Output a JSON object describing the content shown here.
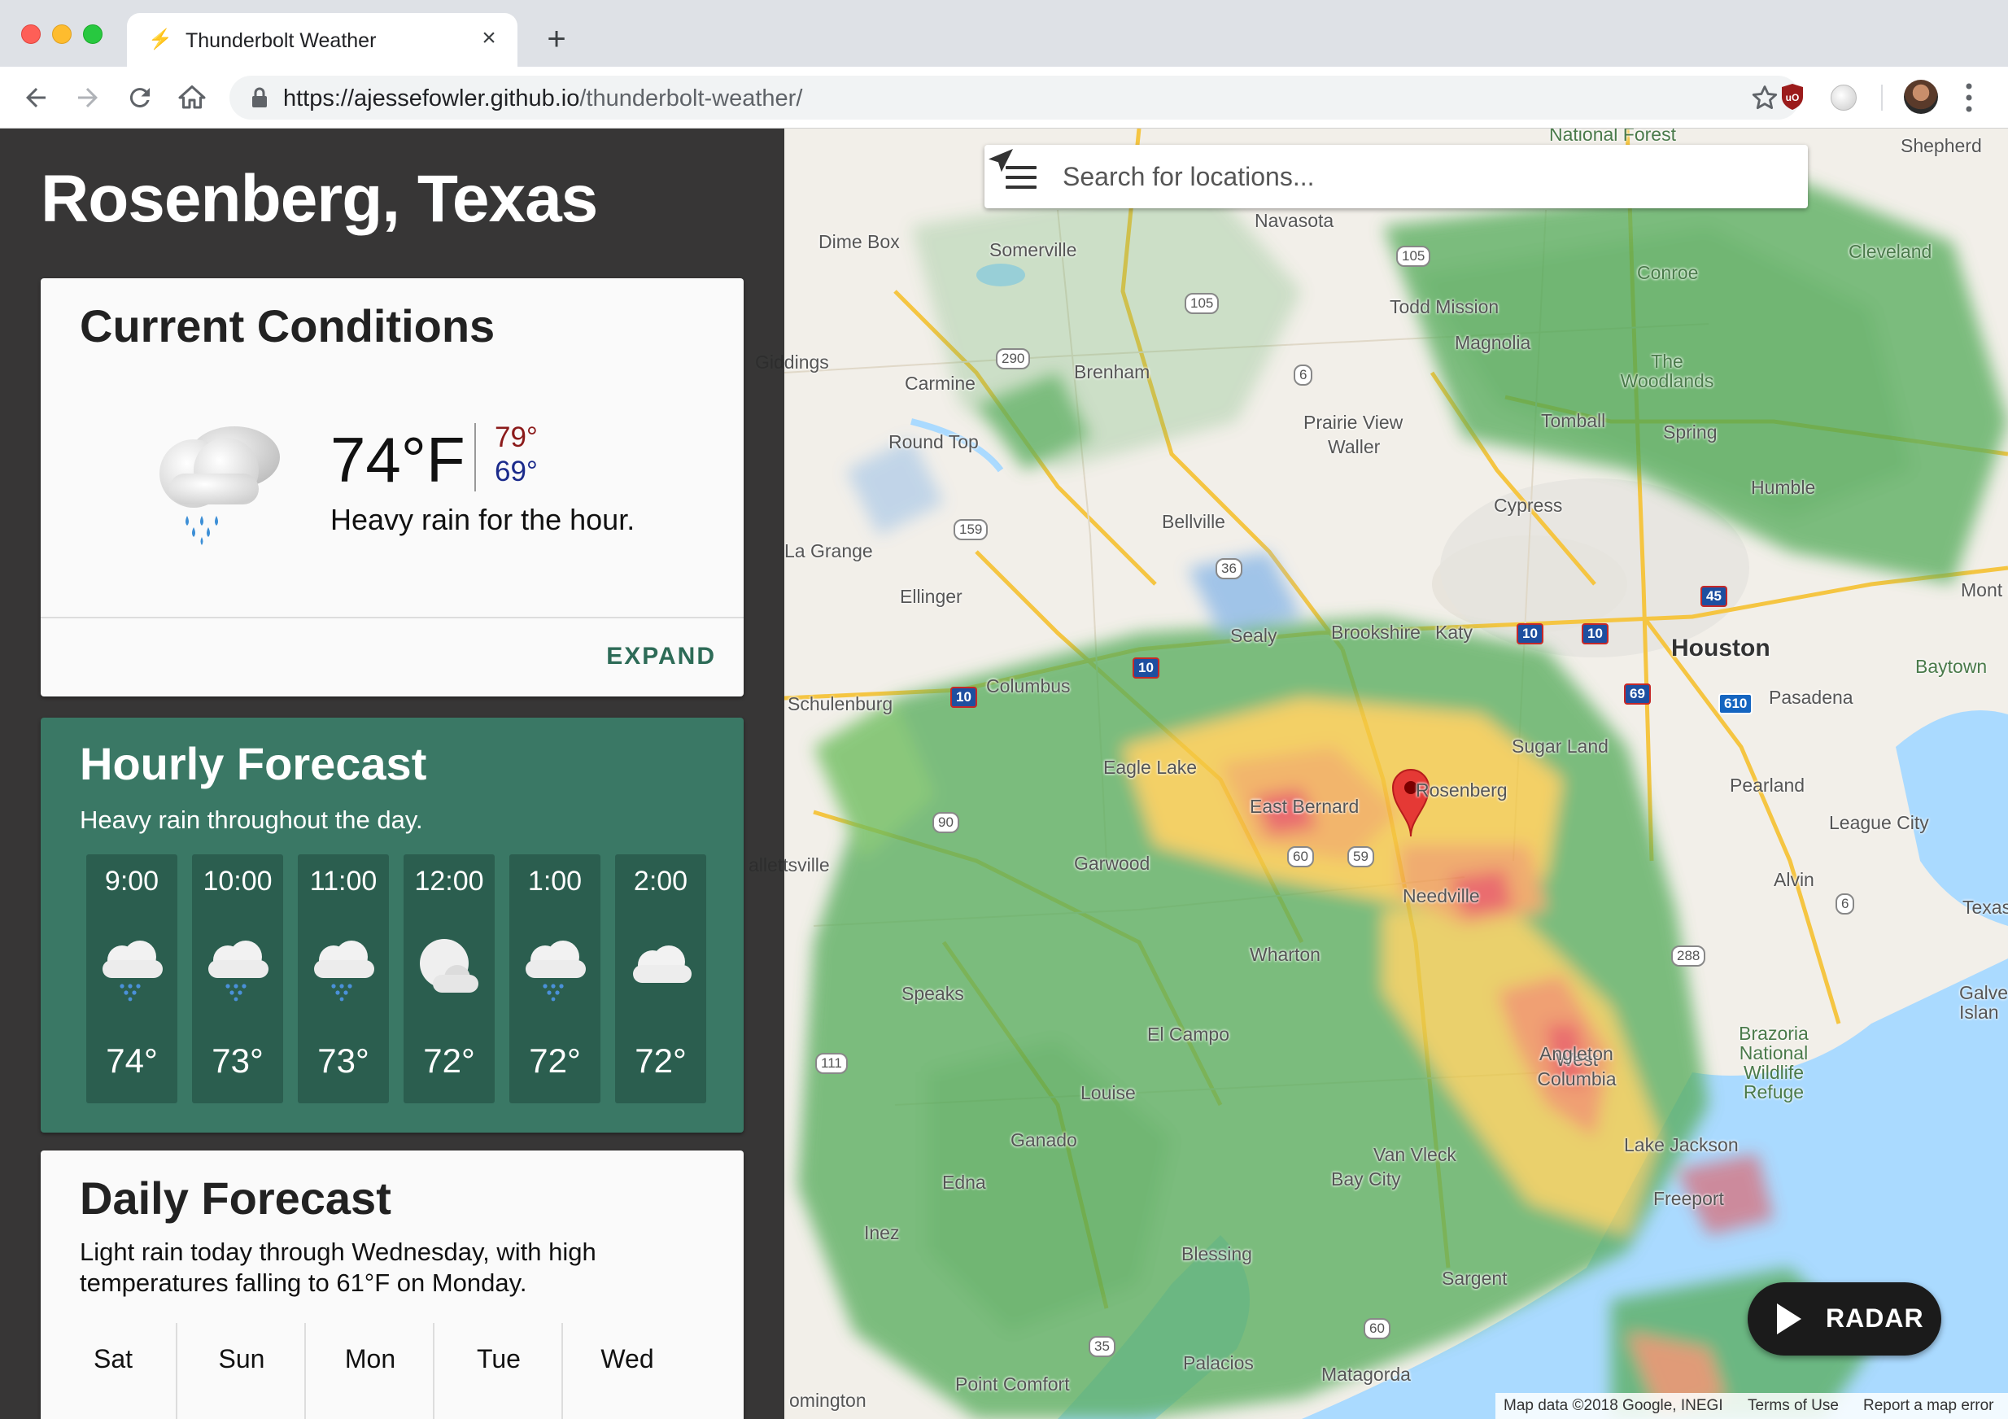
{
  "browser": {
    "tab_title": "Thunderbolt Weather",
    "url_host": "https://ajessefowler.github.io",
    "url_path": "/thunderbolt-weather/"
  },
  "search": {
    "placeholder": "Search for locations..."
  },
  "location": {
    "title": "Rosenberg, Texas"
  },
  "current": {
    "title": "Current Conditions",
    "temp": "74°F",
    "high": "79°",
    "low": "69°",
    "summary": "Heavy rain for the hour.",
    "icon": "rain-icon",
    "expand_label": "EXPAND"
  },
  "hourly": {
    "title": "Hourly Forecast",
    "summary": "Heavy rain throughout the day.",
    "hours": [
      {
        "time": "9:00",
        "temp": "74°",
        "icon": "rain-icon"
      },
      {
        "time": "10:00",
        "temp": "73°",
        "icon": "rain-icon"
      },
      {
        "time": "11:00",
        "temp": "73°",
        "icon": "rain-icon"
      },
      {
        "time": "12:00",
        "temp": "72°",
        "icon": "partly-cloudy-night-icon"
      },
      {
        "time": "1:00",
        "temp": "72°",
        "icon": "rain-icon"
      },
      {
        "time": "2:00",
        "temp": "72°",
        "icon": "cloudy-icon"
      }
    ]
  },
  "daily": {
    "title": "Daily Forecast",
    "summary": "Light rain today through Wednesday, with high temperatures falling to 61°F on Monday.",
    "days": [
      {
        "name": "Sat",
        "icon": "sun-icon"
      },
      {
        "name": "Sun",
        "icon": "sun-icon"
      },
      {
        "name": "Mon",
        "icon": "cloudy-icon"
      },
      {
        "name": "Tue",
        "icon": "cloudy-icon"
      },
      {
        "name": "Wed",
        "icon": "cloudy-icon"
      }
    ]
  },
  "radar_button": {
    "label": "RADAR"
  },
  "map": {
    "attribution": "Map data ©2018 Google, INEGI",
    "terms": "Terms of Use",
    "report": "Report a map error",
    "places": {
      "houston": "Houston",
      "pasadena": "Pasadena",
      "sugar_land": "Sugar Land",
      "pearland": "Pearland",
      "league_city": "League City",
      "rosenberg": "Rosenberg",
      "sealy": "Sealy",
      "brookshire": "Brookshire",
      "katy": "Katy",
      "columbus": "Columbus",
      "eagle_lake": "Eagle Lake",
      "east_bernard": "East Bernard",
      "needville": "Needville",
      "wharton": "Wharton",
      "el_campo": "El Campo",
      "west_columbia": "West Columbia",
      "navasota": "Navasota",
      "somerville": "Somerville",
      "dime_box": "Dime Box",
      "todd_mission": "Todd Mission",
      "magnolia": "Magnolia",
      "conroe": "Conroe",
      "the_woodlands": "The Woodlands",
      "tomball": "Tomball",
      "spring": "Spring",
      "humble": "Humble",
      "cypress": "Cypress",
      "brenham": "Brenham",
      "carmine": "Carmine",
      "round_top": "Round Top",
      "prairie_view": "Prairie View",
      "waller": "Waller",
      "bellville": "Bellville",
      "la_grange": "La Grange",
      "ellinger": "Ellinger",
      "schulenburg": "Schulenburg",
      "garwood": "Garwood",
      "speaks": "Speaks",
      "louise": "Louise",
      "ganado": "Ganado",
      "edna": "Edna",
      "inez": "Inez",
      "blessing": "Blessing",
      "palacios": "Palacios",
      "point_comfort": "Point Comfort",
      "matagorda": "Matagorda",
      "van_vleck": "Van Vleck",
      "bay_city": "Bay City",
      "sargent": "Sargent",
      "lake_jackson": "Lake Jackson",
      "freeport": "Freeport",
      "angleton": "Angleton",
      "alvin": "Alvin",
      "texas_city": "Texas",
      "galveston": "Galves Islan",
      "baytown": "Baytown",
      "mont_belvieu": "Mont B",
      "cleveland": "Cleveland",
      "shepherd": "Shepherd",
      "giddings": "Giddings",
      "brazoria": "Brazoria National Wildlife Refuge",
      "national_forest": "National Forest",
      "bloomington": "omington",
      "hallettsville": "allettsville"
    }
  }
}
